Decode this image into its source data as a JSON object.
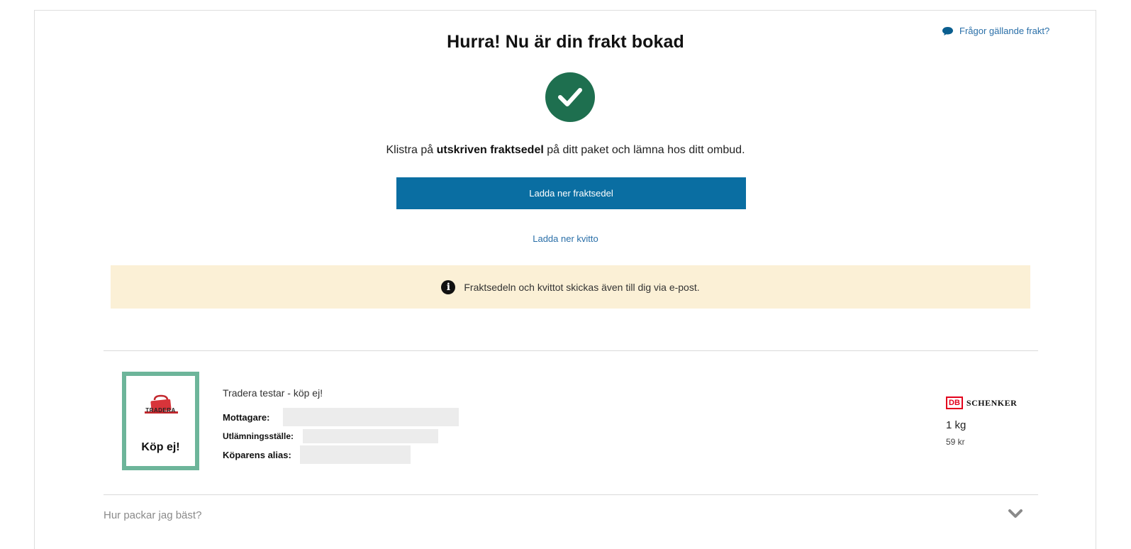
{
  "header": {
    "help_link": "Frågor gällande frakt?",
    "title": "Hurra! Nu är din frakt bokad"
  },
  "instruction": {
    "prefix": "Klistra på ",
    "bold": "utskriven fraktsedel",
    "suffix": " på ditt paket och lämna hos ditt ombud."
  },
  "actions": {
    "download_label": "Ladda ner fraktsedel",
    "receipt_label": "Ladda ner kvitto"
  },
  "notice": {
    "icon": "info-icon",
    "text": "Fraktsedeln och kvittot skickas även till dig via e-post."
  },
  "order": {
    "thumbnail_brand": "TRADERA",
    "thumbnail_text": "Köp ej!",
    "title": "Tradera testar - köp ej!",
    "fields": [
      {
        "label": "Mottagare:"
      },
      {
        "label": "Utlämningsställe:"
      },
      {
        "label": "Köparens alias:"
      }
    ],
    "carrier_db": "DB",
    "carrier_name": "SCHENKER",
    "weight": "1 kg",
    "price": "59 kr"
  },
  "faq": {
    "question": "Hur packar jag bäst?"
  },
  "colors": {
    "primary": "#0a6ea2",
    "success": "#1e6f4f",
    "notice_bg": "#fbf0d6",
    "link": "#2a6fa8",
    "thumb_border": "#6db59a"
  }
}
